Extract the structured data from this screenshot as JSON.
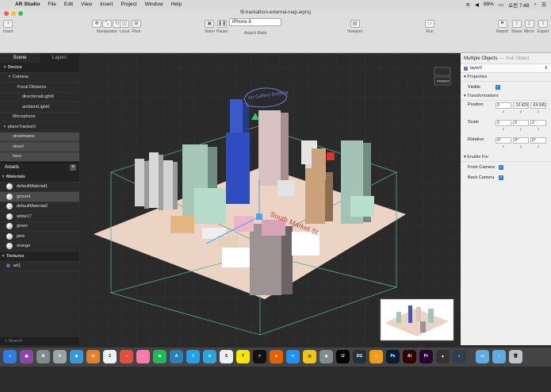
{
  "menubar": {
    "app": "AR Studio",
    "items": [
      "File",
      "Edit",
      "View",
      "Insert",
      "Project",
      "Window",
      "Help"
    ],
    "battery": "89%",
    "clock": "오전 7:48"
  },
  "window": {
    "title": "f8-hackathon-external-map.arproj"
  },
  "toolbar": {
    "insert": "Insert",
    "manipulator": "Manipulator",
    "local": "Local",
    "pivot": "Pivot",
    "video": "Video",
    "pause": "Pause",
    "device": "iPhone 8",
    "aspect": "Aspect Ratio",
    "viewport": "Viewport",
    "run": "Run",
    "report": "Report",
    "share": "Share",
    "mirror": "Mirror",
    "export": "Export"
  },
  "scene": {
    "tabs": [
      "Scene",
      "Layers"
    ],
    "rows": [
      {
        "label": "Device",
        "indent": 0,
        "type": "section"
      },
      {
        "label": "Camera",
        "indent": 1,
        "type": "normal"
      },
      {
        "label": "Focal Distance",
        "indent": 2,
        "type": "normal"
      },
      {
        "label": "directionalLight0",
        "indent": 3,
        "type": "normal"
      },
      {
        "label": "ambientLight0",
        "indent": 3,
        "type": "normal"
      },
      {
        "label": "Microphone",
        "indent": 1,
        "type": "normal"
      },
      {
        "label": "planeTracker0",
        "indent": 0,
        "type": "normal"
      },
      {
        "label": "streetname",
        "indent": 1,
        "type": "selected"
      },
      {
        "label": "street",
        "indent": 1,
        "type": "selected"
      },
      {
        "label": "here",
        "indent": 1,
        "type": "selected"
      }
    ]
  },
  "assets": {
    "title": "Assets",
    "materials_label": "Materials",
    "materials": [
      "defaultMaterial1",
      "ground",
      "defaultMaterial2",
      "white17",
      "green",
      "pink",
      "orange"
    ],
    "textures_label": "Textures",
    "textures": [
      "art1"
    ],
    "search": "Search"
  },
  "viewport": {
    "street_label": "South Market St.",
    "note_label": "Art Gallery Building",
    "front_label": "FRONT"
  },
  "inspector": {
    "title": "Multiple Objects",
    "subtitle": "Null Object",
    "layer": "layer0",
    "properties_label": "Properties",
    "visible_label": "Visible",
    "transformations_label": "Transformations",
    "position_label": "Position",
    "position": [
      "0",
      "-10.429",
      "-64.545"
    ],
    "scale_label": "Scale",
    "scale": [
      "2",
      "2",
      "2"
    ],
    "rotation_label": "Rotation",
    "rotation": [
      "0°",
      "0°",
      "0°"
    ],
    "axes": [
      "x",
      "y",
      "z"
    ],
    "enable_label": "Enable For",
    "front_camera": "Front Camera",
    "back_camera": "Back Camera"
  },
  "dock": {
    "icons": [
      {
        "name": "finder-icon",
        "color": "#2f7de1",
        "glyph": "☺"
      },
      {
        "name": "siri-icon",
        "color": "#8e44ad",
        "glyph": "◉"
      },
      {
        "name": "system-preferences-icon",
        "color": "#7f8c8d",
        "glyph": "⚙"
      },
      {
        "name": "launchpad-icon",
        "color": "#95a5a6",
        "glyph": "✈"
      },
      {
        "name": "drop-icon",
        "color": "#3498db",
        "glyph": "◆"
      },
      {
        "name": "photos-icon",
        "color": "#e67e22",
        "glyph": "✿"
      },
      {
        "name": "calendar-icon",
        "color": "#ecf0f1",
        "glyph": "2"
      },
      {
        "name": "music-icon",
        "color": "#e74c3c",
        "glyph": "♪"
      },
      {
        "name": "itunes-icon",
        "color": "#fd79a8",
        "glyph": "♫"
      },
      {
        "name": "spotify-icon",
        "color": "#1db954",
        "glyph": "≋"
      },
      {
        "name": "app-store-icon",
        "color": "#2980b9",
        "glyph": "A"
      },
      {
        "name": "twitter-icon",
        "color": "#1da1f2",
        "glyph": "✦"
      },
      {
        "name": "telegram-icon",
        "color": "#2aa3df",
        "glyph": "➤"
      },
      {
        "name": "slack-icon",
        "color": "#ecf0f1",
        "glyph": "S"
      },
      {
        "name": "kakaotalk-icon",
        "color": "#f7e600",
        "glyph": "T"
      },
      {
        "name": "terminal-icon",
        "color": "#111111",
        "glyph": ">"
      },
      {
        "name": "firefox-icon",
        "color": "#e66000",
        "glyph": "●"
      },
      {
        "name": "safari-icon",
        "color": "#1e90ff",
        "glyph": "✧"
      },
      {
        "name": "chrome-icon",
        "color": "#f1c40f",
        "glyph": "◎"
      },
      {
        "name": "git-icon",
        "color": "#7f8c8d",
        "glyph": "◈"
      },
      {
        "name": "intellij-icon",
        "color": "#000000",
        "glyph": "IJ"
      },
      {
        "name": "datagrip-icon",
        "color": "#22303c",
        "glyph": "DG"
      },
      {
        "name": "sketch-icon",
        "color": "#f39c12",
        "glyph": "◇"
      },
      {
        "name": "photoshop-icon",
        "color": "#001d34",
        "glyph": "Ps"
      },
      {
        "name": "illustrator-icon",
        "color": "#330000",
        "glyph": "Ai"
      },
      {
        "name": "premiere-icon",
        "color": "#2a0033",
        "glyph": "Pr"
      },
      {
        "name": "ar-studio-icon",
        "color": "#333333",
        "glyph": "▲"
      },
      {
        "name": "browser-icon",
        "color": "#2c3e50",
        "glyph": "◐"
      },
      {
        "name": "folder-icon",
        "color": "#5dade2",
        "glyph": "▭"
      },
      {
        "name": "downloads-icon",
        "color": "#5dade2",
        "glyph": "↓"
      },
      {
        "name": "trash-icon",
        "color": "#bdc3c7",
        "glyph": "🗑"
      }
    ]
  }
}
